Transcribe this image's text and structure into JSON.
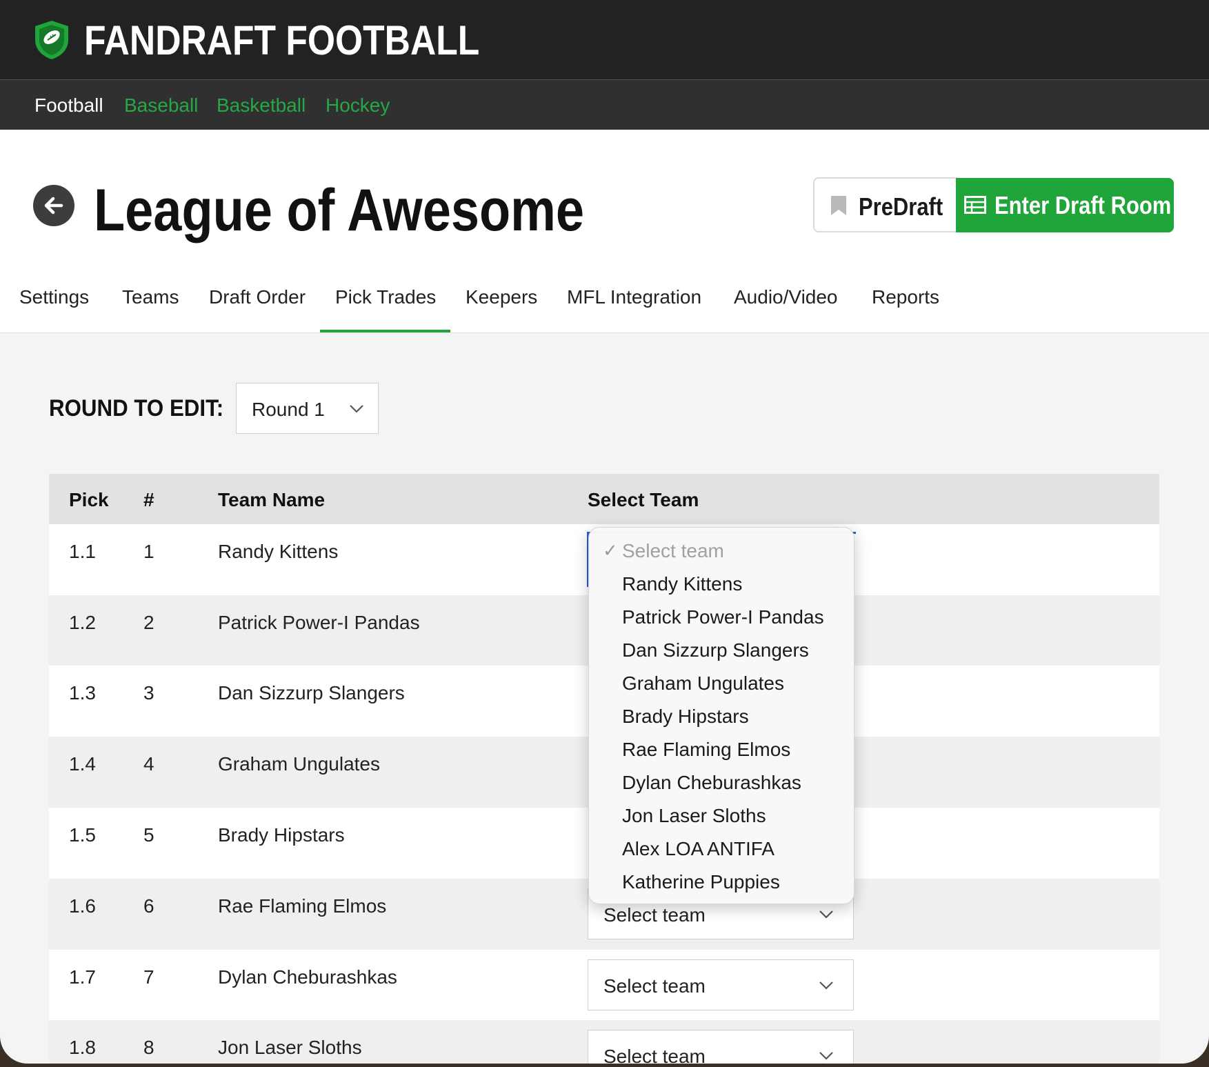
{
  "brand": {
    "name": "FANDRAFT FOOTBALL",
    "accent": "#1fa53a"
  },
  "sports": [
    {
      "label": "Football",
      "active": true
    },
    {
      "label": "Baseball",
      "active": false
    },
    {
      "label": "Basketball",
      "active": false
    },
    {
      "label": "Hockey",
      "active": false
    }
  ],
  "page": {
    "title": "League of Awesome",
    "predraft_label": "PreDraft",
    "enter_label": "Enter Draft Room"
  },
  "tabs": [
    {
      "label": "Settings"
    },
    {
      "label": "Teams"
    },
    {
      "label": "Draft Order"
    },
    {
      "label": "Pick Trades",
      "active": true
    },
    {
      "label": "Keepers"
    },
    {
      "label": "MFL Integration"
    },
    {
      "label": "Audio/Video"
    },
    {
      "label": "Reports"
    }
  ],
  "round": {
    "label": "ROUND TO EDIT:",
    "value": "Round 1"
  },
  "table": {
    "headers": {
      "pick": "Pick",
      "num": "#",
      "team": "Team Name",
      "select": "Select Team"
    },
    "rows": [
      {
        "pick": "1.1",
        "num": "1",
        "team": "Randy Kittens",
        "select": "Select team"
      },
      {
        "pick": "1.2",
        "num": "2",
        "team": "Patrick Power-I Pandas",
        "select": "Select team"
      },
      {
        "pick": "1.3",
        "num": "3",
        "team": "Dan Sizzurp Slangers",
        "select": "Select team"
      },
      {
        "pick": "1.4",
        "num": "4",
        "team": "Graham Ungulates",
        "select": "Select team"
      },
      {
        "pick": "1.5",
        "num": "5",
        "team": "Brady Hipstars",
        "select": "Select team"
      },
      {
        "pick": "1.6",
        "num": "6",
        "team": "Rae Flaming Elmos",
        "select": "Select team"
      },
      {
        "pick": "1.7",
        "num": "7",
        "team": "Dylan Cheburashkas",
        "select": "Select team"
      },
      {
        "pick": "1.8",
        "num": "8",
        "team": "Jon Laser Sloths",
        "select": "Select team"
      }
    ]
  },
  "dropdown": {
    "placeholder": "Select team",
    "options": [
      "Randy Kittens",
      "Patrick Power-I Pandas",
      "Dan Sizzurp Slangers",
      "Graham Ungulates",
      "Brady Hipstars",
      "Rae Flaming Elmos",
      "Dylan Cheburashkas",
      "Jon Laser Sloths",
      "Alex LOA ANTIFA",
      "Katherine Puppies"
    ]
  }
}
